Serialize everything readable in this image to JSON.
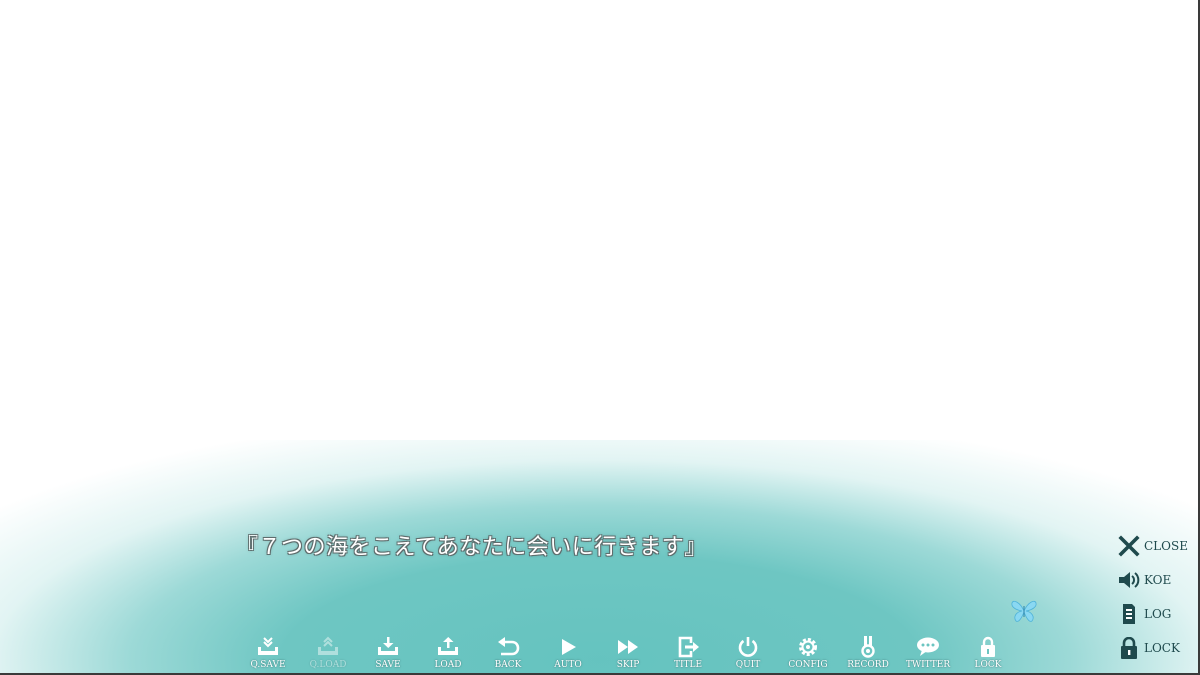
{
  "dialogue": {
    "text": "『７つの海をこえてあなたに会いに行きます』"
  },
  "toolbar": {
    "items": [
      {
        "label": "Q.SAVE",
        "icon": "quick-save-icon"
      },
      {
        "label": "Q.LOAD",
        "icon": "quick-load-icon"
      },
      {
        "label": "SAVE",
        "icon": "save-icon"
      },
      {
        "label": "LOAD",
        "icon": "load-icon"
      },
      {
        "label": "BACK",
        "icon": "back-arrow-icon"
      },
      {
        "label": "AUTO",
        "icon": "play-icon"
      },
      {
        "label": "SKIP",
        "icon": "fast-forward-icon"
      },
      {
        "label": "TITLE",
        "icon": "exit-door-icon"
      },
      {
        "label": "QUIT",
        "icon": "power-icon"
      },
      {
        "label": "CONFIG",
        "icon": "gear-icon"
      },
      {
        "label": "RECORD",
        "icon": "medal-icon"
      },
      {
        "label": "TWITTER",
        "icon": "speech-bubble-icon"
      },
      {
        "label": "LOCK",
        "icon": "padlock-icon"
      }
    ]
  },
  "side_menu": {
    "items": [
      {
        "label": "CLOSE",
        "icon": "close-icon"
      },
      {
        "label": "KOE",
        "icon": "speaker-icon"
      },
      {
        "label": "LOG",
        "icon": "log-list-icon"
      },
      {
        "label": "LOCK",
        "icon": "padlock-icon"
      }
    ]
  },
  "colors": {
    "window_teal": "#6cc5c1",
    "side_icon": "#1f4a4d",
    "butterfly": "#7fd4f0"
  }
}
